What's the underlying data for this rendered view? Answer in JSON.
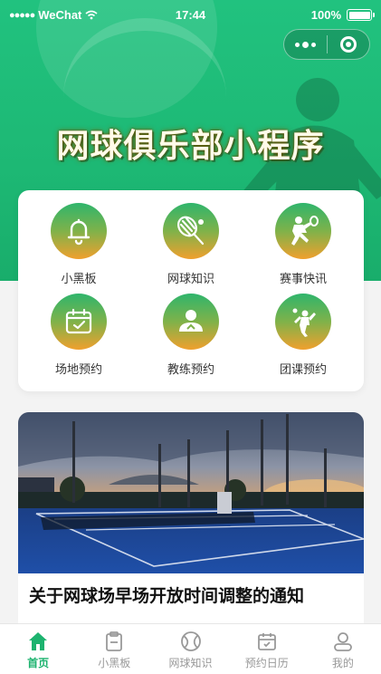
{
  "status_bar": {
    "carrier": "WeChat",
    "time": "17:44",
    "battery": "100%"
  },
  "hero": {
    "title": "网球俱乐部小程序"
  },
  "menu": {
    "items": [
      {
        "label": "小黑板",
        "icon": "bell-icon"
      },
      {
        "label": "网球知识",
        "icon": "racket-icon"
      },
      {
        "label": "赛事快讯",
        "icon": "player-icon"
      },
      {
        "label": "场地预约",
        "icon": "calendar-check-icon"
      },
      {
        "label": "教练预约",
        "icon": "coach-icon"
      },
      {
        "label": "团课预约",
        "icon": "serve-icon"
      }
    ]
  },
  "news": {
    "title": "关于网球场早场开放时间调整的通知"
  },
  "tabbar": {
    "tabs": [
      {
        "label": "首页",
        "icon": "home-icon",
        "active": true
      },
      {
        "label": "小黑板",
        "icon": "clipboard-icon",
        "active": false
      },
      {
        "label": "网球知识",
        "icon": "tennis-ball-icon",
        "active": false
      },
      {
        "label": "预约日历",
        "icon": "calendar-icon",
        "active": false
      },
      {
        "label": "我的",
        "icon": "profile-icon",
        "active": false
      }
    ]
  },
  "colors": {
    "brand_green": "#1db874",
    "tab_active": "#1db36f",
    "tab_inactive": "#999999",
    "icon_gradient_top": "#2fb56c",
    "icon_gradient_bottom": "#f0a02e"
  }
}
